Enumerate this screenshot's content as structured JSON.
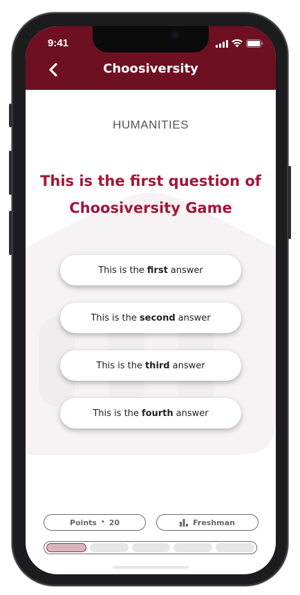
{
  "status": {
    "time": "9:41"
  },
  "header": {
    "brand": "Choosiversity"
  },
  "question": {
    "subject": "HUMANITIES",
    "text_line1": "This is the first question of",
    "text_line2": "Choosiversity Game"
  },
  "answers": [
    {
      "pre": "This is the",
      "bold": "first",
      "post": "answer"
    },
    {
      "pre": "This is the",
      "bold": "second",
      "post": "answer"
    },
    {
      "pre": "This is the",
      "bold": "third",
      "post": "answer"
    },
    {
      "pre": "This is the",
      "bold": "fourth",
      "post": "answer"
    }
  ],
  "footer": {
    "points_label": "Points",
    "points_separator": "•",
    "points_value": "20",
    "level_label": "Freshman",
    "progress_done": 1,
    "progress_total": 5
  },
  "colors": {
    "header_bg": "#6e0f22",
    "question_text": "#a3163a",
    "progress_done": "#d8b5bd"
  },
  "icons": [
    "back-chevron-icon",
    "signal-icon",
    "wifi-icon",
    "battery-icon",
    "bar-chart-icon"
  ]
}
